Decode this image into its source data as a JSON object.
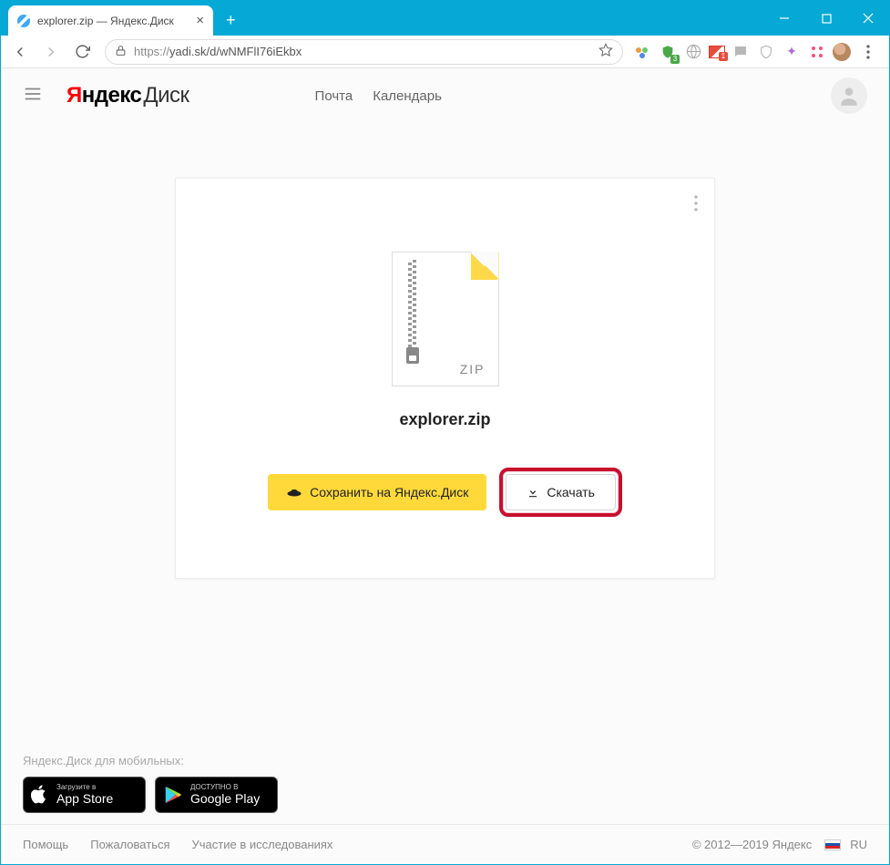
{
  "browser": {
    "tab_title": "explorer.zip — Яндекс.Диск",
    "url_scheme": "https://",
    "url_rest": "yadi.sk/d/wNMFlI76iEkbx"
  },
  "header": {
    "logo_ya": "Я",
    "logo_ndex": "ндекс",
    "logo_disk": "Диск",
    "links": {
      "mail": "Почта",
      "calendar": "Календарь"
    }
  },
  "file": {
    "icon_label": "ZIP",
    "name": "explorer.zip"
  },
  "buttons": {
    "save": "Сохранить на Яндекс.Диск",
    "download": "Скачать"
  },
  "mobile": {
    "caption": "Яндекс.Диск для мобильных:",
    "appstore_small": "Загрузите в",
    "appstore_big": "App Store",
    "gplay_small": "ДОСТУПНО В",
    "gplay_big": "Google Play"
  },
  "footer": {
    "help": "Помощь",
    "report": "Пожаловаться",
    "research": "Участие в исследованиях",
    "copyright": "© 2012—2019 Яндекс",
    "lang": "RU"
  }
}
